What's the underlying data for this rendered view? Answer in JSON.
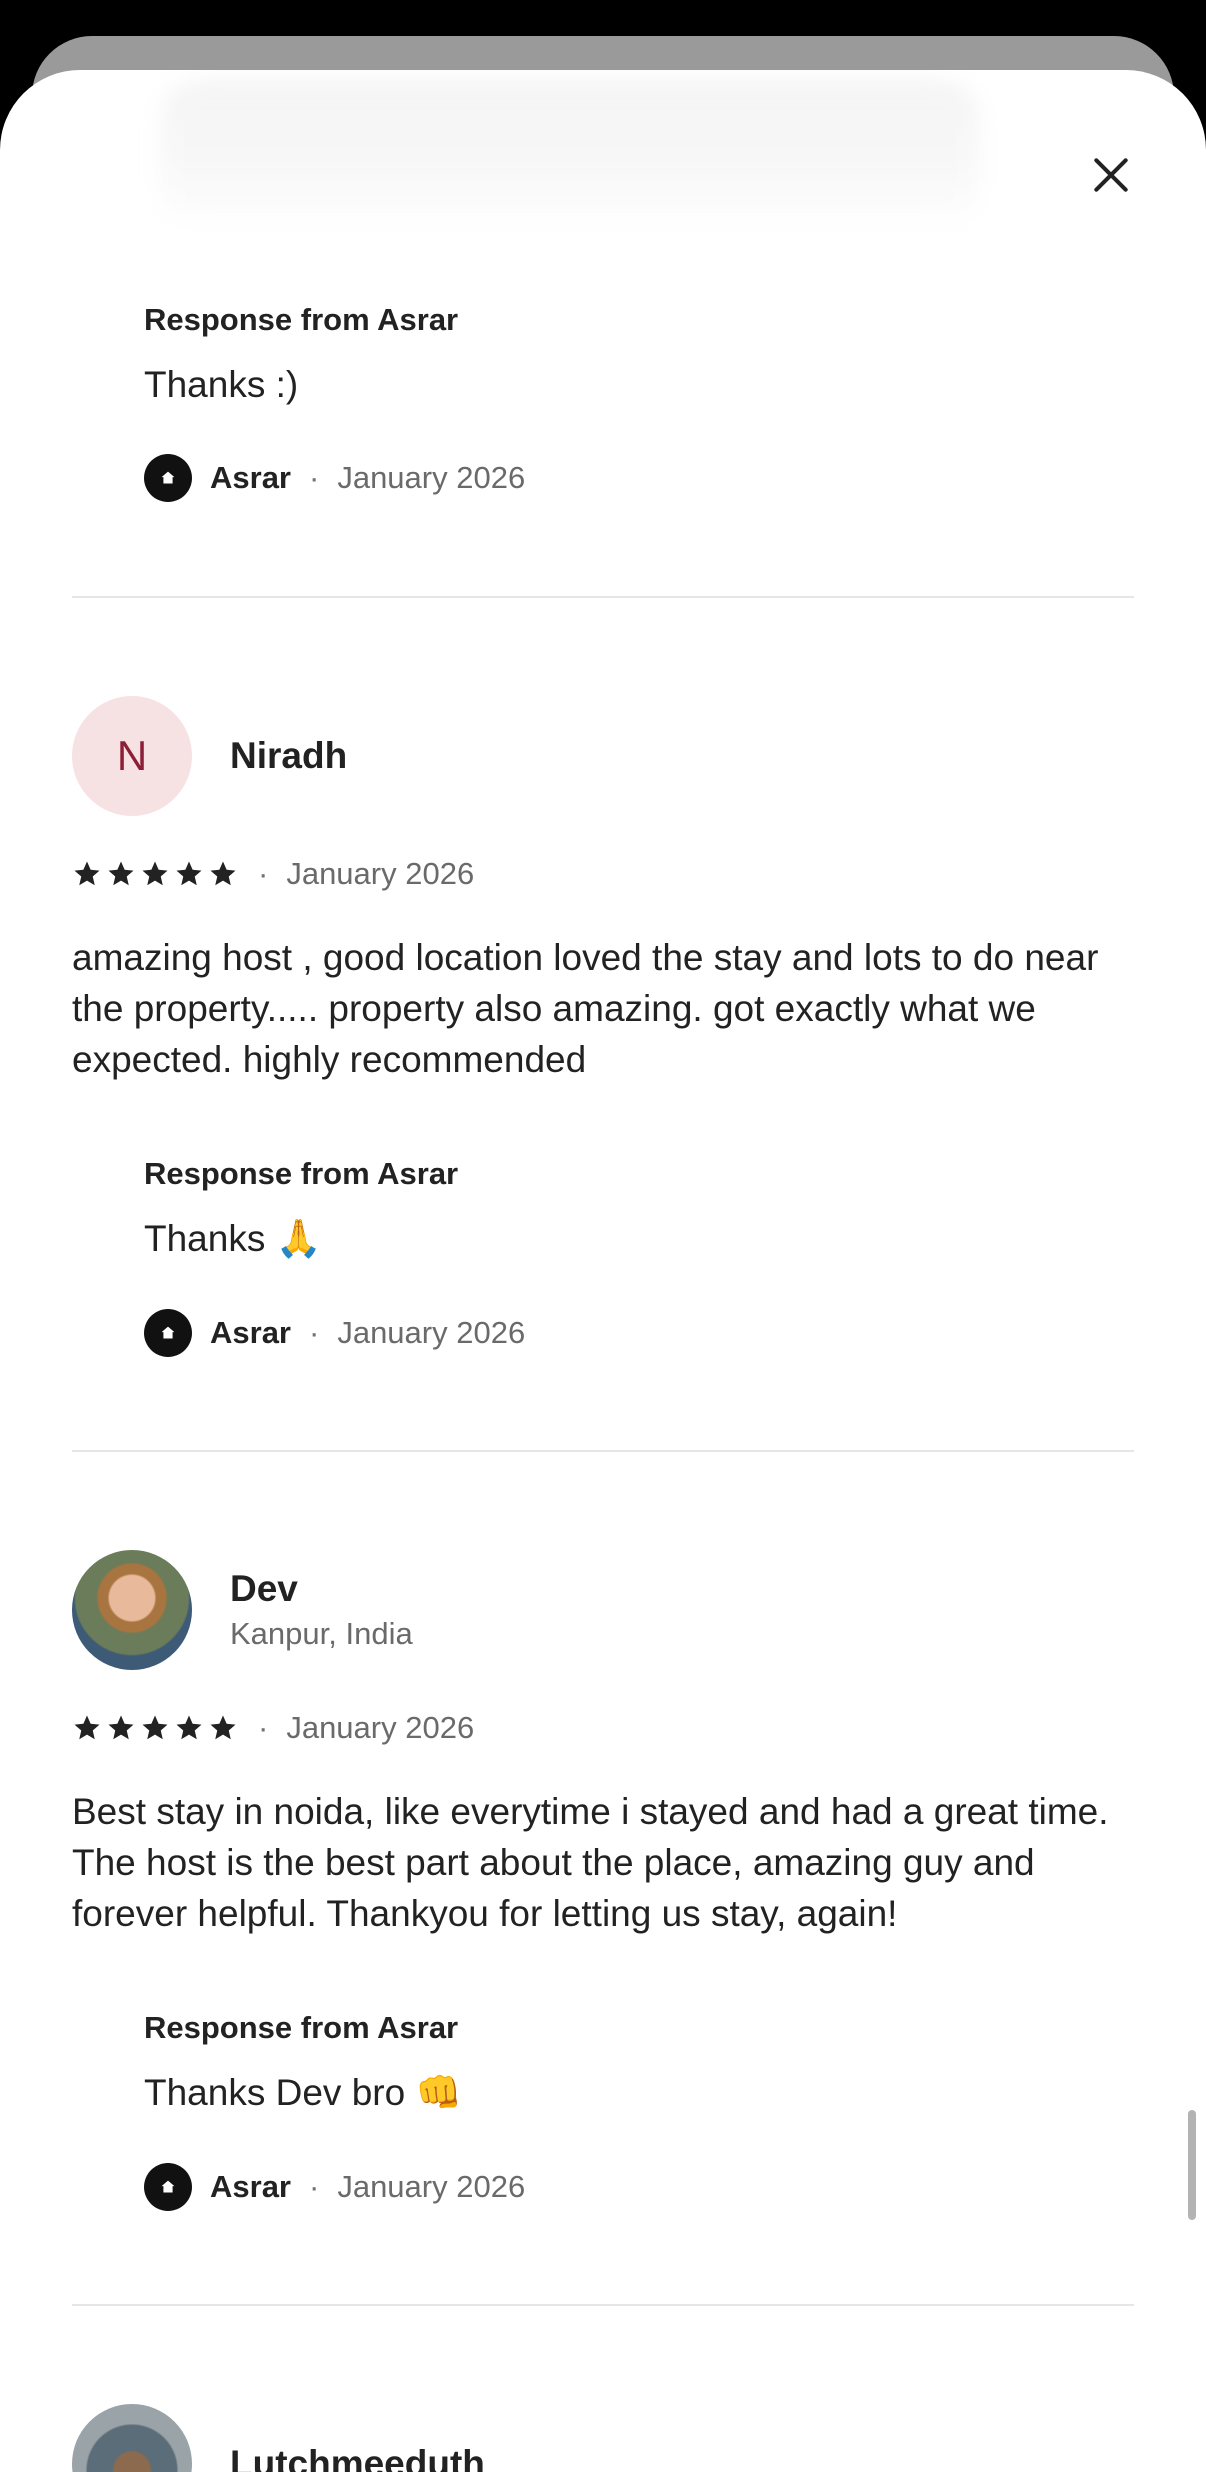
{
  "header": {
    "close_icon": "close-icon"
  },
  "reviews": [
    {
      "partial": true,
      "response": {
        "title": "Response from Asrar",
        "text": "Thanks :)",
        "host": "Asrar",
        "separator": "·",
        "date": "January 2026"
      }
    },
    {
      "initial": "N",
      "name": "Niradh",
      "location": "",
      "rating": 5,
      "separator": "·",
      "date": "January 2026",
      "text": "amazing host , good location loved the stay and lots to do near the property..... property also amazing. got exactly what we expected. highly recommended",
      "response": {
        "title": "Response from Asrar",
        "text": "Thanks 🙏",
        "host": "Asrar",
        "separator": "·",
        "date": "January 2026"
      }
    },
    {
      "name": "Dev",
      "location": "Kanpur, India",
      "rating": 5,
      "separator": "·",
      "date": "January 2026",
      "text": "Best stay in noida, like everytime i stayed and had a great time. The host is the best part about the place, amazing guy and forever helpful. Thankyou for letting us stay, again!",
      "response": {
        "title": "Response from Asrar",
        "text": "Thanks Dev bro 👊",
        "host": "Asrar",
        "separator": "·",
        "date": "January 2026"
      }
    },
    {
      "name": "Lutchmeeduth"
    }
  ],
  "colors": {
    "initial_bg": "#f6e1e3",
    "initial_fg": "#8e1d37",
    "text": "#222222",
    "muted": "#6a6a6a"
  }
}
